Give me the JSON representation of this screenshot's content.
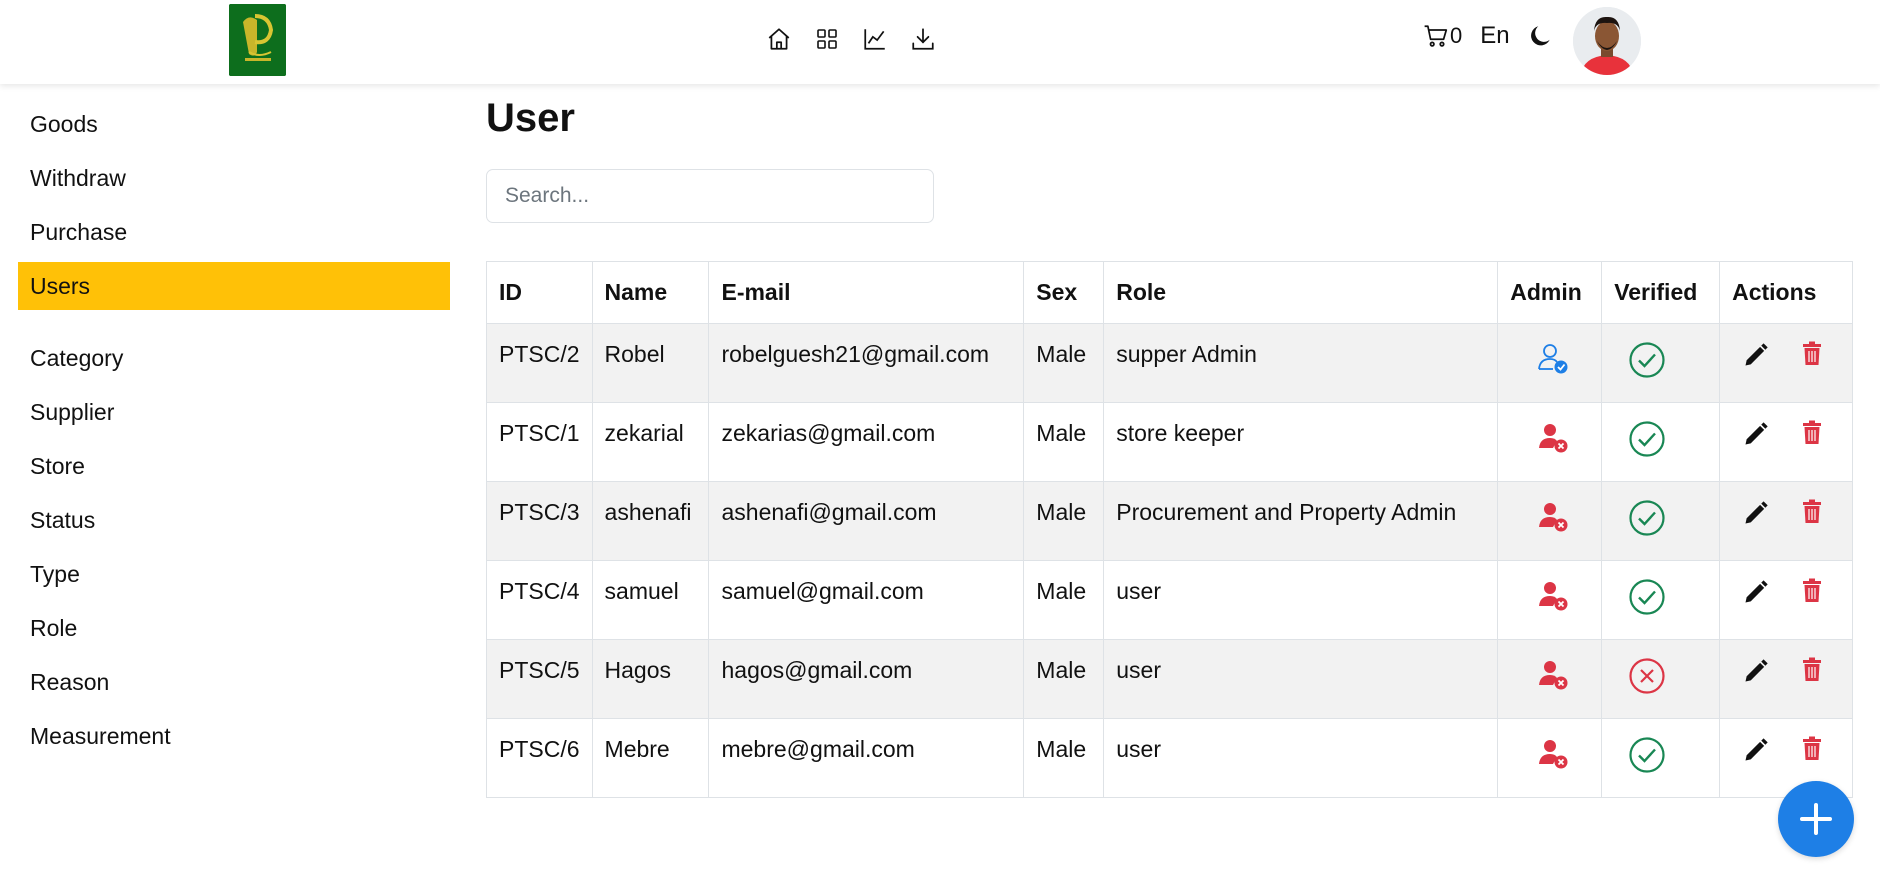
{
  "header": {
    "logo_icon": "company-logo",
    "nav_icons": [
      "home-icon",
      "grid-icon",
      "chart-line-icon",
      "download-icon"
    ],
    "cart_count": "0",
    "language": "En",
    "theme_icon": "moon-icon",
    "avatar": "user-avatar"
  },
  "sidebar": {
    "group1": [
      {
        "label": "Goods"
      },
      {
        "label": "Withdraw"
      },
      {
        "label": "Purchase"
      },
      {
        "label": "Users"
      }
    ],
    "group2": [
      {
        "label": "Category"
      },
      {
        "label": "Supplier"
      },
      {
        "label": "Store"
      },
      {
        "label": "Status"
      },
      {
        "label": "Type"
      },
      {
        "label": "Role"
      },
      {
        "label": "Reason"
      },
      {
        "label": "Measurement"
      }
    ],
    "active": "Users",
    "active_color": "#ffc107"
  },
  "main": {
    "title": "User",
    "search_placeholder": "Search...",
    "columns": [
      "ID",
      "Name",
      "E-mail",
      "Sex",
      "Role",
      "Admin",
      "Verified",
      "Actions"
    ],
    "rows": [
      {
        "id": "PTSC/2",
        "name": "Robel",
        "email": "robelguesh21@gmail.com",
        "sex": "Male",
        "role": "supper Admin",
        "admin": true,
        "verified": true
      },
      {
        "id": "PTSC/1",
        "name": "zekarial",
        "email": "zekarias@gmail.com",
        "sex": "Male",
        "role": "store keeper",
        "admin": false,
        "verified": true
      },
      {
        "id": "PTSC/3",
        "name": "ashenafi",
        "email": "ashenafi@gmail.com",
        "sex": "Male",
        "role": "Procurement and Property Admin",
        "admin": false,
        "verified": true
      },
      {
        "id": "PTSC/4",
        "name": "samuel",
        "email": "samuel@gmail.com",
        "sex": "Male",
        "role": "user",
        "admin": false,
        "verified": true
      },
      {
        "id": "PTSC/5",
        "name": "Hagos",
        "email": "hagos@gmail.com",
        "sex": "Male",
        "role": "user",
        "admin": false,
        "verified": false
      },
      {
        "id": "PTSC/6",
        "name": "Mebre",
        "email": "mebre@gmail.com",
        "sex": "Male",
        "role": "user",
        "admin": false,
        "verified": true
      }
    ],
    "fab_icon": "plus-icon"
  },
  "colors": {
    "admin_yes": "#1e7fe6",
    "admin_no": "#dc3545",
    "verified_yes": "#198754",
    "verified_no": "#dc3545",
    "delete": "#dc3545",
    "fab": "#1e7fe6",
    "stripe": "#f2f2f2"
  }
}
